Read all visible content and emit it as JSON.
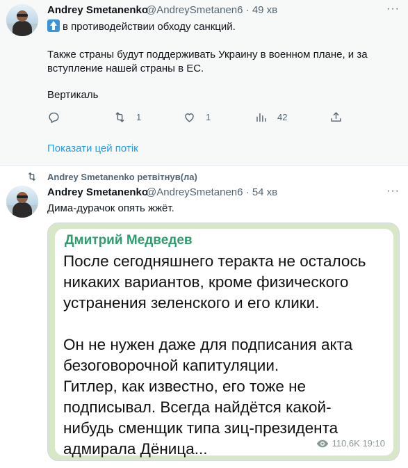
{
  "tweet1": {
    "author_name": "Andrey Smetanenko",
    "author_handle": "@AndreySmetanen6",
    "time": "· 49 хв",
    "more": "···",
    "line1": "в противодействии обходу санкций.",
    "line2": "Также страны будут поддерживать Украину в военном плане, и за",
    "line3": "вступление нашей страны в ЕС.",
    "line4": "Вертикаль",
    "reply_count": "",
    "retweet_count": "1",
    "like_count": "1",
    "views_count": "42",
    "show_thread": "Показати цей потік"
  },
  "retweet_header": "Andrey Smetanenko ретвітнув(ла)",
  "tweet2": {
    "author_name": "Andrey Smetanenko",
    "author_handle": "@AndreySmetanen6",
    "time": "· 54 хв",
    "more": "···",
    "text": "Дима-дурачок опять жжёт.",
    "card": {
      "author": "Дмитрий Медведев",
      "lines": [
        "После сегодняшнего теракта не осталось",
        "никаких вариантов, кроме физического",
        "устранения зеленского и его клики.",
        "",
        "Он не нужен даже для подписания акта",
        "безоговорочной капитуляции.",
        "Гитлер, как известно, его тоже не",
        "подписывал. Всегда найдётся какой-",
        "нибудь сменщик типа зиц-президента",
        "адмирала Дёница..."
      ],
      "views": "110,6K",
      "time": "19:10"
    }
  },
  "colors": {
    "accent": "#1d9bf0",
    "telegram_name": "#2e9c6c"
  }
}
